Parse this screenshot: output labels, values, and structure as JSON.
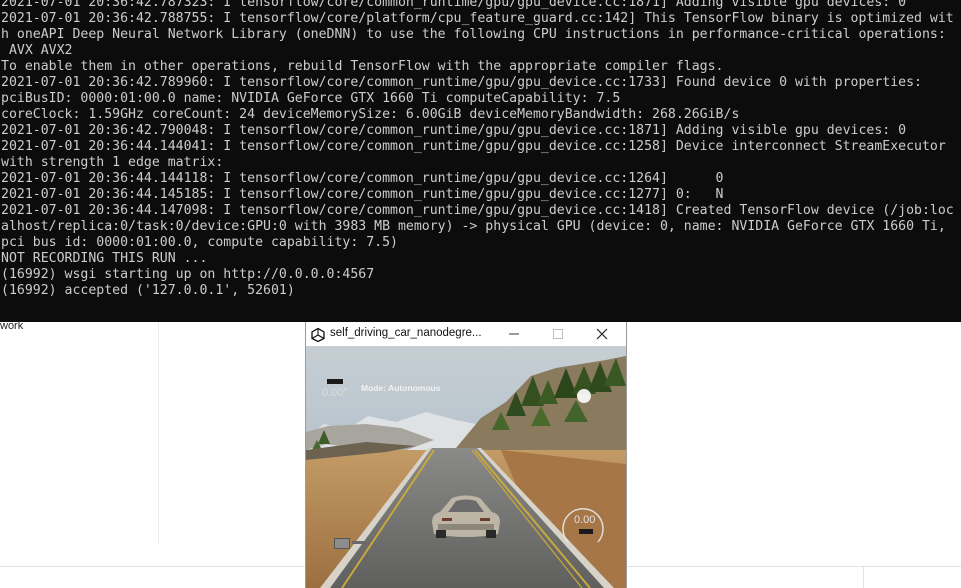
{
  "terminal": {
    "lines": [
      "2021-07-01 20:36:42.787323: I tensorflow/core/common_runtime/gpu/gpu_device.cc:1871] Adding visible gpu devices: 0",
      "2021-07-01 20:36:42.788755: I tensorflow/core/platform/cpu_feature_guard.cc:142] This TensorFlow binary is optimized wit",
      "h oneAPI Deep Neural Network Library (oneDNN) to use the following CPU instructions in performance-critical operations:",
      " AVX AVX2",
      "To enable them in other operations, rebuild TensorFlow with the appropriate compiler flags.",
      "2021-07-01 20:36:42.789960: I tensorflow/core/common_runtime/gpu/gpu_device.cc:1733] Found device 0 with properties:",
      "pciBusID: 0000:01:00.0 name: NVIDIA GeForce GTX 1660 Ti computeCapability: 7.5",
      "coreClock: 1.59GHz coreCount: 24 deviceMemorySize: 6.00GiB deviceMemoryBandwidth: 268.26GiB/s",
      "2021-07-01 20:36:42.790048: I tensorflow/core/common_runtime/gpu/gpu_device.cc:1871] Adding visible gpu devices: 0",
      "2021-07-01 20:36:44.144041: I tensorflow/core/common_runtime/gpu/gpu_device.cc:1258] Device interconnect StreamExecutor",
      "with strength 1 edge matrix:",
      "2021-07-01 20:36:44.144118: I tensorflow/core/common_runtime/gpu/gpu_device.cc:1264]      0",
      "2021-07-01 20:36:44.145185: I tensorflow/core/common_runtime/gpu/gpu_device.cc:1277] 0:   N",
      "2021-07-01 20:36:44.147098: I tensorflow/core/common_runtime/gpu/gpu_device.cc:1418] Created TensorFlow device (/job:loc",
      "alhost/replica:0/task:0/device:GPU:0 with 3983 MB memory) -> physical GPU (device: 0, name: NVIDIA GeForce GTX 1660 Ti,",
      "pci bus id: 0000:01:00.0, compute capability: 7.5)",
      "NOT RECORDING THIS RUN ...",
      "(16992) wsgi starting up on http://0.0.0.0:4567",
      "(16992) accepted ('127.0.0.1', 52601)"
    ]
  },
  "background": {
    "partial_text": "work"
  },
  "unity_window": {
    "title": "self_driving_car_nanodegre...",
    "icon": "unity-logo-icon",
    "buttons": {
      "minimize_icon": "minimize-icon",
      "maximize_icon": "maximize-icon",
      "close_icon": "close-icon"
    },
    "hud": {
      "mode": "Mode: Autonomous",
      "steering_angle": "0.00°",
      "speed": "0.00"
    }
  },
  "colors": {
    "terminal_bg": "#0c0c0c",
    "terminal_fg": "#cccccc",
    "sky": "#b9c7d2",
    "sand": "#b88a55",
    "road": "#6e6e6e",
    "lane_yellow": "#c9a83a"
  }
}
